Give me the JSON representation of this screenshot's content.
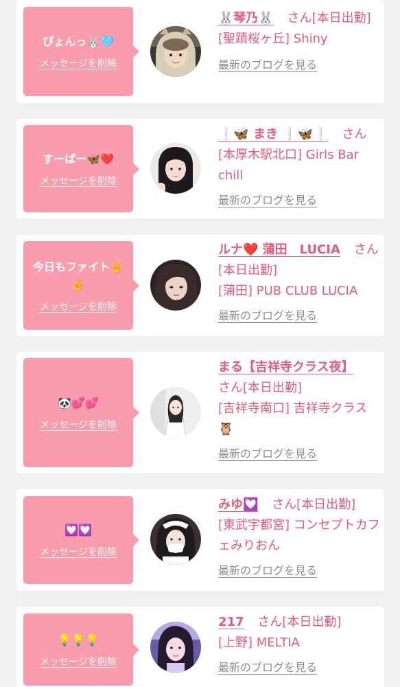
{
  "labels": {
    "delete": "メッセージを削除",
    "blog": "最新のブログを見る"
  },
  "colors": {
    "background": "#f2f0f1",
    "card": "#ffffff",
    "bubble": "#f99cad",
    "accent": "#e65a7b",
    "blog_link": "#8f8f8f"
  },
  "cards": [
    {
      "message": "ぴょんっ🐰🩵",
      "name": "🐰琴乃🐰",
      "suffix": "さん[本日出勤]",
      "shop": "[聖蹟桜ヶ丘] Shiny",
      "avatar_icon": "cat-hood-selfie"
    },
    {
      "message": "すーぱー🦋❤️",
      "name": "❕🦋 まき ❕🦋❕",
      "suffix": "さん",
      "shop": "[本厚木駅北口] Girls Bar chill",
      "avatar_icon": "long-hair-portrait"
    },
    {
      "message": "今日もファイト✌️✌️",
      "name": "ルナ❤️ 蒲田　LUCIA",
      "suffix": "さん[本日出勤]",
      "shop": "[蒲田] PUB CLUB LUCIA",
      "avatar_icon": "dark-hair-portrait"
    },
    {
      "message": "🐼💕💕",
      "name": "まる【吉祥寺クラス夜】",
      "suffix": "さん[本日出勤]",
      "shop": "[吉祥寺南口] 吉祥寺クラス🦉",
      "avatar_icon": "white-dress-portrait"
    },
    {
      "message": "💟💟",
      "name": "みゆ💟",
      "suffix": "さん[本日出勤]",
      "shop": "[東武宇都宮] コンセプトカフェみりおん",
      "avatar_icon": "maid-portrait"
    },
    {
      "message": "💡💡💡",
      "name": "217",
      "suffix": "さん[本日出勤]",
      "shop": "[上野] MELTIA",
      "avatar_icon": "purple-portrait"
    }
  ]
}
